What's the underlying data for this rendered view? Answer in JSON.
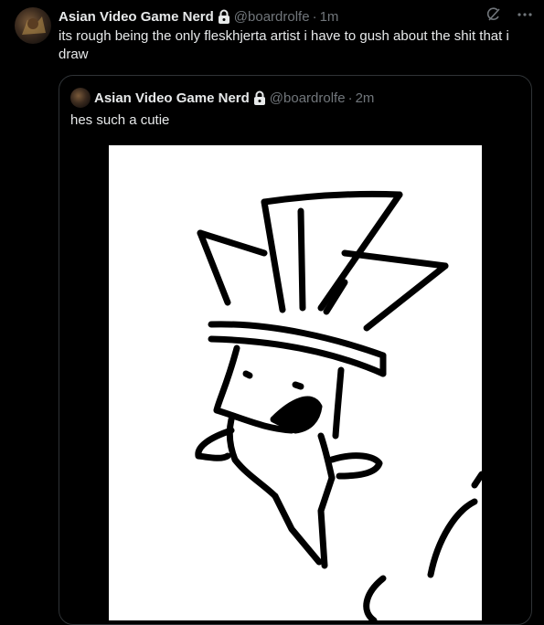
{
  "tweet": {
    "author_name": "Asian Video Game Nerd",
    "handle": "@boardrolfe",
    "separator": "·",
    "time": "1m",
    "text": "its rough being the only fleskhjerta artist i have to gush about the shit that i draw"
  },
  "quoted_tweet": {
    "author_name": "Asian Video Game Nerd",
    "handle": "@boardrolfe",
    "separator": "·",
    "time": "2m",
    "text": "hes such a cutie"
  },
  "icons": {
    "lock": "lock-icon",
    "grok": "grok-icon",
    "more": "more-icon"
  }
}
